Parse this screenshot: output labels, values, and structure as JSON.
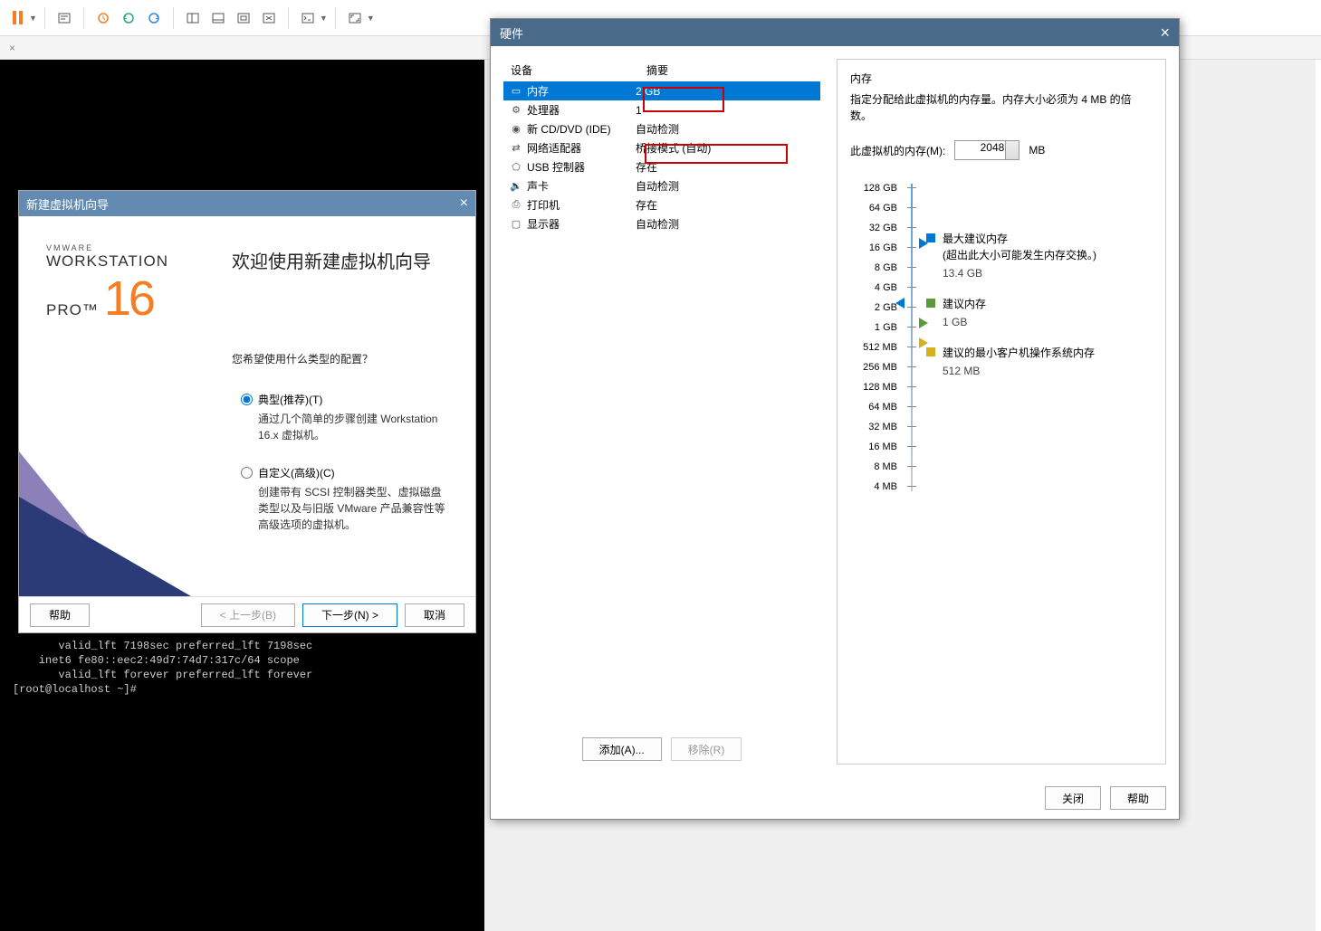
{
  "toolbar": {
    "icons": [
      "pause",
      "send",
      "refresh-orange",
      "refresh-blue",
      "refresh-green",
      "layout-split",
      "layout-bottom",
      "layout-fit",
      "layout-scale",
      "terminal",
      "fullscreen"
    ]
  },
  "terminal": {
    "lines": [
      "       valid_lft 7198sec preferred_lft 7198sec",
      "    inet6 fe80::eec2:49d7:74d7:317c/64 scope ",
      "       valid_lft forever preferred_lft forever",
      "[root@localhost ~]#"
    ]
  },
  "wizard": {
    "title": "新建虚拟机向导",
    "logo": {
      "vm": "VMWARE",
      "ws": "WORKSTATION",
      "pro": "PRO™",
      "num": "16"
    },
    "welcome": "欢迎使用新建虚拟机向导",
    "question": "您希望使用什么类型的配置？",
    "opt1": {
      "label": "典型(推荐)(T)",
      "desc": "通过几个简单的步骤创建 Workstation 16.x 虚拟机。"
    },
    "opt2": {
      "label": "自定义(高级)(C)",
      "desc": "创建带有 SCSI 控制器类型、虚拟磁盘类型以及与旧版 VMware 产品兼容性等高级选项的虚拟机。"
    },
    "buttons": {
      "help": "帮助",
      "back": "< 上一步(B)",
      "next": "下一步(N) >",
      "cancel": "取消"
    }
  },
  "hw": {
    "title": "硬件",
    "headers": {
      "device": "设备",
      "summary": "摘要"
    },
    "rows": [
      {
        "icon": "memory",
        "name": "内存",
        "summary": "2 GB",
        "selected": true
      },
      {
        "icon": "cpu",
        "name": "处理器",
        "summary": "1"
      },
      {
        "icon": "cd",
        "name": "新 CD/DVD (IDE)",
        "summary": "自动检测"
      },
      {
        "icon": "net",
        "name": "网络适配器",
        "summary": "桥接模式 (自动)"
      },
      {
        "icon": "usb",
        "name": "USB 控制器",
        "summary": "存在"
      },
      {
        "icon": "sound",
        "name": "声卡",
        "summary": "自动检测"
      },
      {
        "icon": "printer",
        "name": "打印机",
        "summary": "存在"
      },
      {
        "icon": "display",
        "name": "显示器",
        "summary": "自动检测"
      }
    ],
    "add": "添加(A)...",
    "remove": "移除(R)",
    "right": {
      "title": "内存",
      "desc": "指定分配给此虚拟机的内存量。内存大小必须为 4 MB 的倍数。",
      "mem_label": "此虚拟机的内存(M):",
      "mem_value": "2048",
      "mem_unit": "MB",
      "scale": [
        "128 GB",
        "64 GB",
        "32 GB",
        "16 GB",
        "8 GB",
        "4 GB",
        "2 GB",
        "1 GB",
        "512 MB",
        "256 MB",
        "128 MB",
        "64 MB",
        "32 MB",
        "16 MB",
        "8 MB",
        "4 MB"
      ],
      "legend": {
        "max": {
          "label": "最大建议内存",
          "note": "(超出此大小可能发生内存交换。)",
          "value": "13.4 GB"
        },
        "rec": {
          "label": "建议内存",
          "value": "1 GB"
        },
        "min": {
          "label": "建议的最小客户机操作系统内存",
          "value": "512 MB"
        }
      }
    },
    "footer": {
      "close": "关闭",
      "help": "帮助"
    }
  }
}
